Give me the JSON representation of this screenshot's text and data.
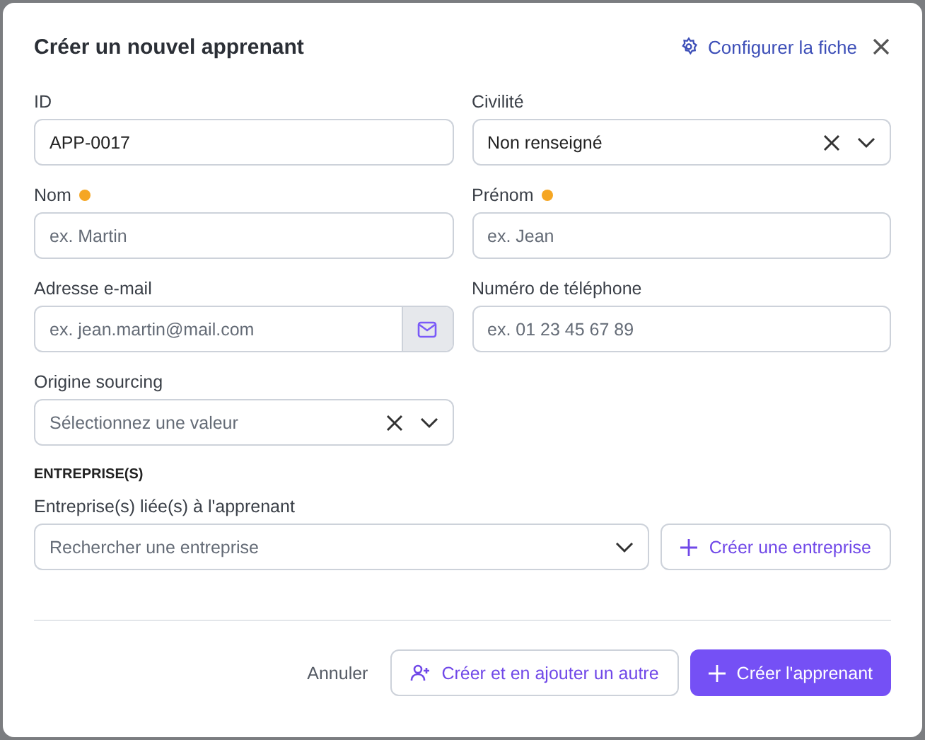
{
  "dialog": {
    "title": "Créer un nouvel apprenant",
    "configure_link": "Configurer la fiche"
  },
  "fields": [
    {
      "label": "ID",
      "kind": "text",
      "value": "APP-0017",
      "required": false
    },
    {
      "label": "Civilité",
      "kind": "select",
      "value": "Non renseigné",
      "required": false
    },
    {
      "label": "Nom",
      "kind": "text",
      "placeholder": "ex. Martin",
      "required": true
    },
    {
      "label": "Prénom",
      "kind": "text",
      "placeholder": "ex. Jean",
      "required": true
    },
    {
      "label": "Adresse e-mail",
      "kind": "email",
      "placeholder": "ex. jean.martin@mail.com",
      "required": false
    },
    {
      "label": "Numéro de téléphone",
      "kind": "text",
      "placeholder": "ex. 01 23 45 67 89",
      "required": false
    },
    {
      "label": "Origine sourcing",
      "kind": "select",
      "placeholder": "Sélectionnez une valeur",
      "required": false
    }
  ],
  "section": {
    "title": "ENTREPRISE(S)",
    "label": "Entreprise(s) liée(s) à l'apprenant",
    "placeholder": "Rechercher une entreprise",
    "create_button": "Créer une entreprise"
  },
  "footer": {
    "cancel": "Annuler",
    "secondary": "Créer et en ajouter un autre",
    "primary": "Créer l'apprenant"
  }
}
